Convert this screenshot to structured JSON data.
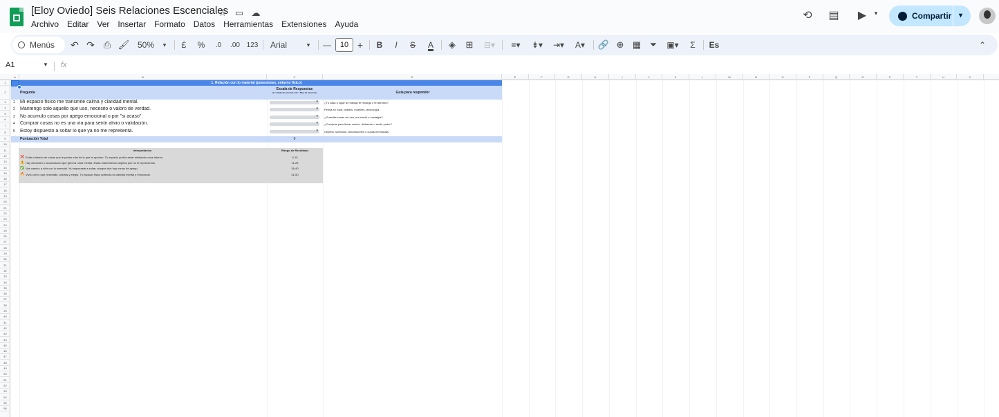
{
  "window": {
    "doc_title": "[Eloy Oviedo] Seis Relaciones Escenciales"
  },
  "menu": [
    "Archivo",
    "Editar",
    "Ver",
    "Insertar",
    "Formato",
    "Datos",
    "Herramientas",
    "Extensiones",
    "Ayuda"
  ],
  "share": {
    "label": "Compartir"
  },
  "toolbar": {
    "search_label": "Menús",
    "zoom": "50%",
    "currency": "£",
    "percent": "%",
    "dec_decrease": ".0",
    "dec_increase": ".00",
    "number_format": "123",
    "font": "Arial",
    "font_size": "10",
    "bold": "B",
    "italic": "I",
    "strike": "S",
    "text_color": "A",
    "minus": "—",
    "plus": "+",
    "sigma": "Σ",
    "input_tools": "Es"
  },
  "formula_bar": {
    "name_box": "A1",
    "fx": "fx"
  },
  "columns": [
    "A",
    "B",
    "C",
    "D",
    "E",
    "F",
    "G",
    "H",
    "I",
    "J",
    "K",
    "L",
    "M",
    "N",
    "O",
    "P",
    "Q",
    "R",
    "S",
    "T",
    "U",
    "V"
  ],
  "rows": [
    "1",
    "2",
    "3",
    "4",
    "5",
    "6",
    "7",
    "8",
    "9",
    "10",
    "11",
    "12",
    "13",
    "14",
    "15",
    "16",
    "17",
    "18",
    "19",
    "20",
    "21",
    "22",
    "23",
    "24",
    "25",
    "26",
    "27",
    "28",
    "29",
    "30",
    "31",
    "32",
    "33",
    "34",
    "35",
    "36",
    "37",
    "38",
    "39",
    "40",
    "41",
    "42",
    "43",
    "44",
    "45",
    "46",
    "47",
    "48",
    "49",
    "50",
    "51",
    "52",
    "53",
    "54",
    "55",
    "56"
  ],
  "sheet": {
    "title": "1. Relación con lo material (posesiones, entorno físico)",
    "header_question": "Pregunta",
    "header_scale": "Escala de Respuestas",
    "header_scale_sub": "(0 = Nada de acuerdo | 10 = Muy de acuerdo)",
    "header_guide": "Guía para responder",
    "questions": [
      {
        "n": "1",
        "text": "Mi espacio físico me transmite calma y claridad mental.",
        "guide": "¿Tu casa o lugar de trabajo te recarga o te abruma?"
      },
      {
        "n": "2",
        "text": "Mantengo solo aquello que uso, necesito o valoro de verdad.",
        "guide": "Pensá en ropa, objetos, muebles, tecnología."
      },
      {
        "n": "3",
        "text": "No acumulo cosas por apego emocional o por \"si acaso\".",
        "guide": "¿Guardás cosas sin uso por miedo o nostalgia?"
      },
      {
        "n": "4",
        "text": "Comprar cosas no es una vía para sentir alivio o validación.",
        "guide": "¿Comprás para llenar vacíos, distraerte o sentir poder?"
      },
      {
        "n": "5",
        "text": "Estoy dispuesto a soltar lo que ya no me representa.",
        "guide": "Objetos, símbolos, decoraciones o cosas heredadas."
      }
    ],
    "total_label": "Puntuación Total",
    "total_value": "0",
    "interp_header": "Interpretación",
    "range_header": "Rango de Resultado",
    "interpretations": [
      {
        "icon": "❌",
        "text": "Estás rodeado de cosas que te pesan más de lo que te aportan. Tu espacio podría estar reflejando caos interno.",
        "range": "0-10"
      },
      {
        "icon": "⚠️",
        "text": "Hay desorden o acumulación que genera ruido mental. Estás manteniendo objetos que no te representan.",
        "range": "11-25"
      },
      {
        "icon": "✅",
        "text": "Vas camino a vivir con lo esencial. Ya empezaste a soltar, aunque aún hay zonas de apego.",
        "range": "26-40"
      },
      {
        "icon": "🔥",
        "text": "Vivís con lo que necesitás, valorás y elegís. Tu espacio físico potencia tu claridad mental y emocional.",
        "range": "41-50"
      }
    ]
  },
  "colors": {
    "sheet_title_band": "#4a86e8",
    "header_band": "#c9daf8",
    "total_band": "#c9daf8",
    "interp_band": "#d9d9d9",
    "share_bg": "#c2e7ff"
  }
}
